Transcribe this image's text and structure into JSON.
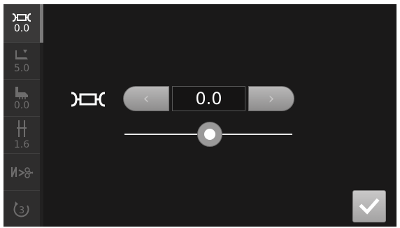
{
  "sidebar": {
    "items": [
      {
        "icon": "stitch-width-icon",
        "value": "0.0",
        "active": true
      },
      {
        "icon": "presser-foot-icon",
        "value": "5.0",
        "active": false
      },
      {
        "icon": "foot-pressure-icon",
        "value": "0.0",
        "active": false
      },
      {
        "icon": "needle-position-icon",
        "value": "1.6",
        "active": false
      },
      {
        "icon": "thread-cutter-icon",
        "value": "",
        "active": false
      },
      {
        "icon": "reverse-count-icon",
        "value": "3",
        "active": false
      }
    ]
  },
  "main": {
    "setting_icon": "stitch-width-icon",
    "stepper": {
      "value": "0.0",
      "left_label": "‹",
      "right_label": "›"
    },
    "slider": {
      "level": 0.5
    },
    "ok_icon": "checkmark-icon"
  },
  "colors": {
    "background": "#1a1919",
    "sidebar": "#2e2d2d",
    "accent": "#ffffff"
  }
}
